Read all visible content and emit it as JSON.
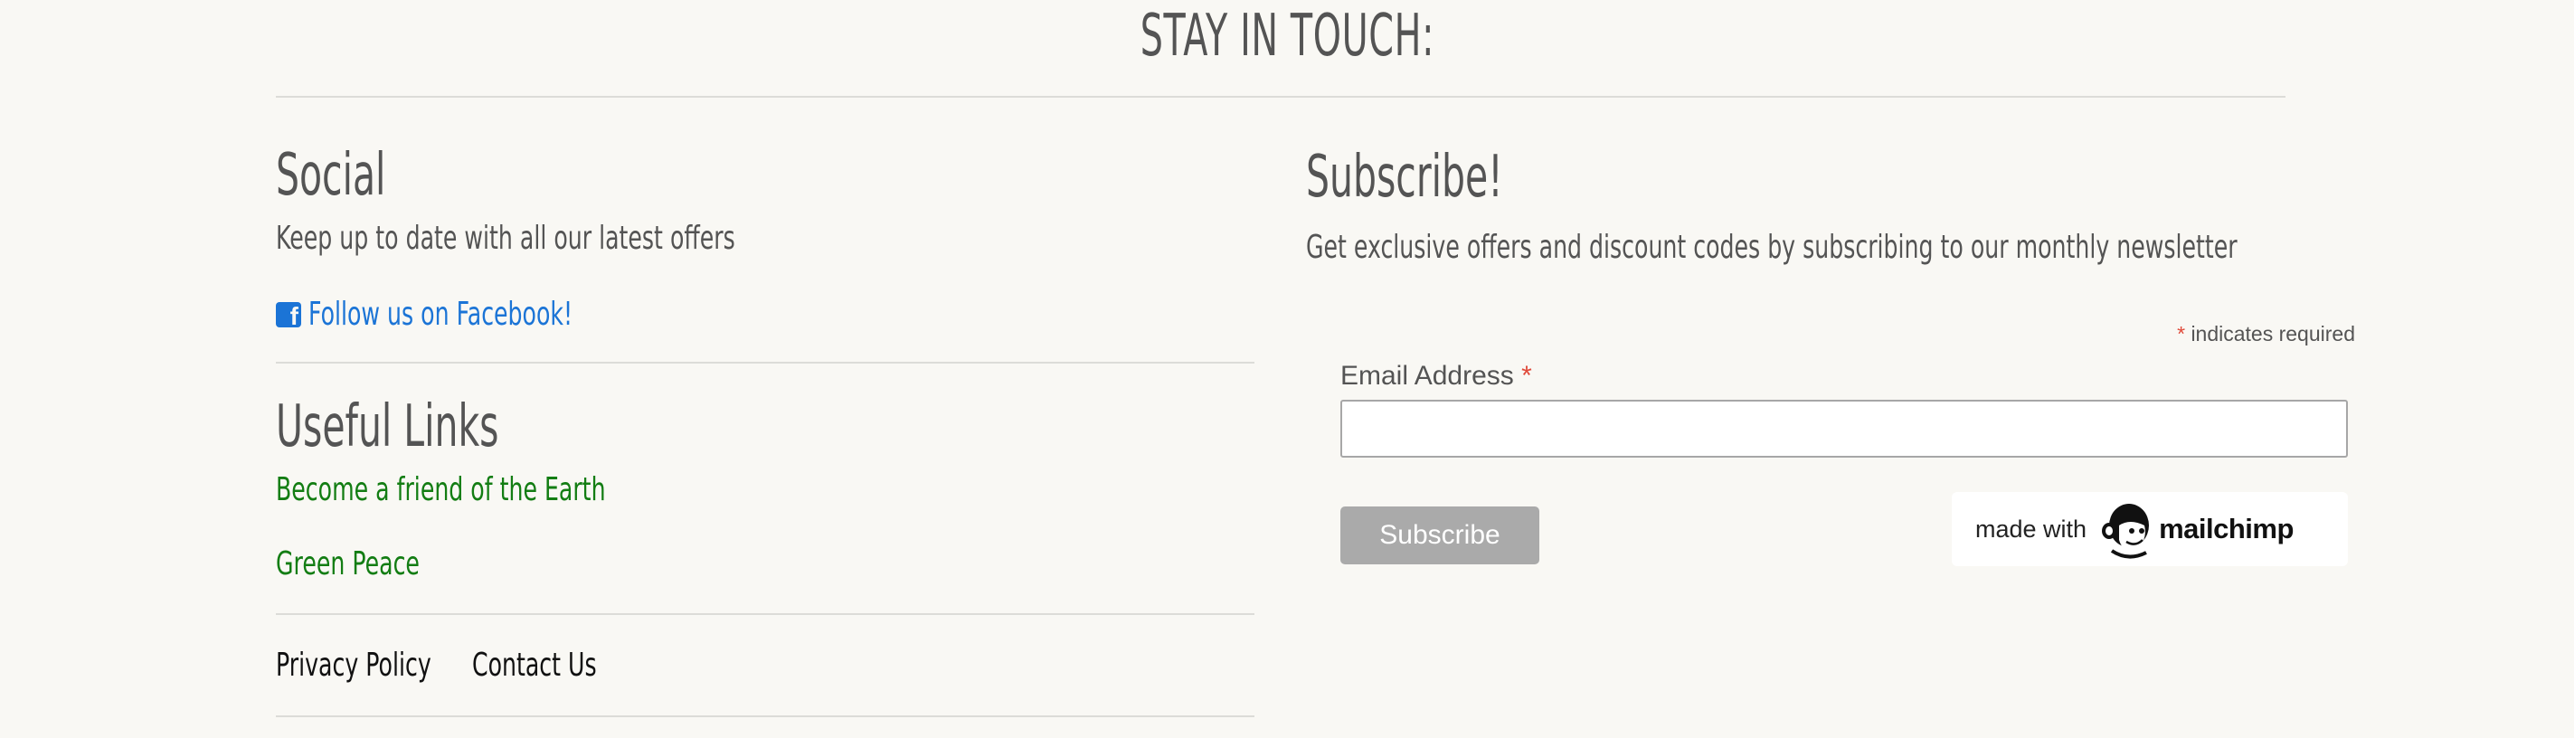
{
  "page": {
    "title": "STAY IN TOUCH:"
  },
  "social": {
    "heading": "Social",
    "description": "Keep up to date with all our latest offers",
    "facebook_link": "Follow us on Facebook!",
    "facebook_icon": "facebook-square-icon",
    "link_color": "#1b74d6"
  },
  "useful_links": {
    "heading": "Useful Links",
    "links": [
      "Become a friend of the Earth",
      "Green Peace"
    ],
    "link_color": "#137d13"
  },
  "footer_links": [
    "Privacy Policy",
    "Contact Us"
  ],
  "subscribe": {
    "heading": "Subscribe!",
    "description": "Get exclusive offers and discount codes by subscribing to our monthly newsletter",
    "required_marker": "*",
    "required_note": "indicates required",
    "email_label": "Email Address",
    "email_value": "",
    "button_label": "Subscribe",
    "badge": {
      "prefix": "made with",
      "brand": "mailchimp",
      "logo_icon": "mailchimp-freddie-icon"
    }
  },
  "colors": {
    "background": "#f9f8f4",
    "text": "#545454",
    "required": "#e04a3a",
    "button": "#aaaaaa"
  }
}
